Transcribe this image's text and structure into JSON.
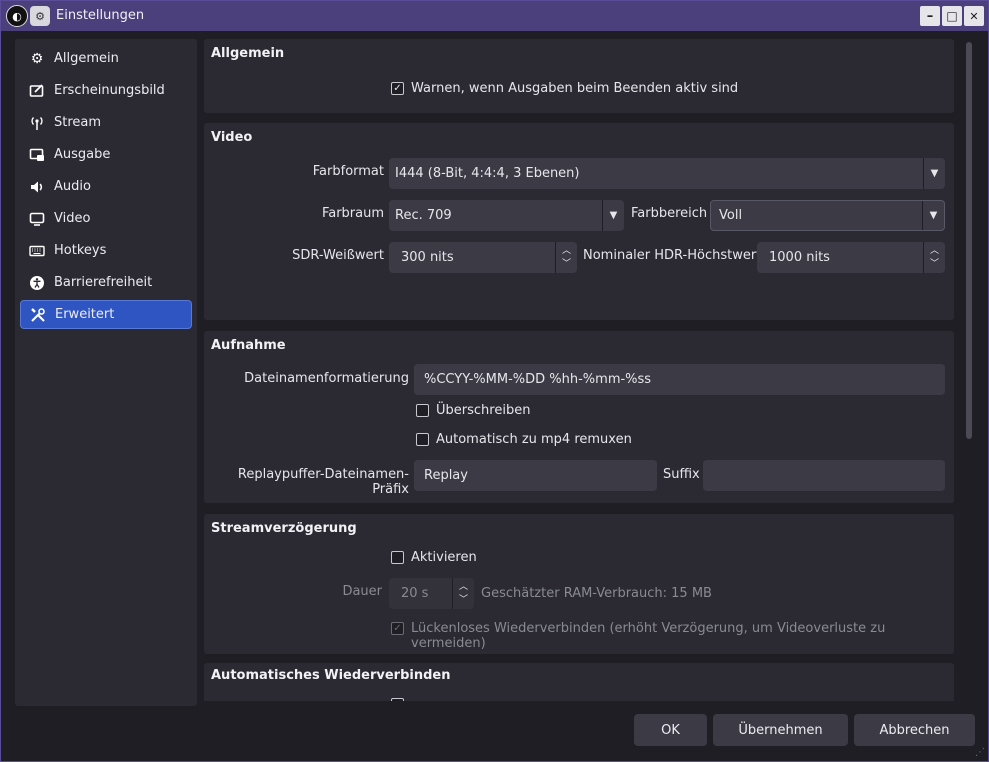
{
  "window": {
    "title": "Einstellungen",
    "buttons": {
      "minimize": "–",
      "maximize": "□",
      "close": "✕"
    }
  },
  "sidebar": {
    "items": [
      {
        "label": "Allgemein",
        "icon": "gear-icon"
      },
      {
        "label": "Erscheinungsbild",
        "icon": "appearance-icon"
      },
      {
        "label": "Stream",
        "icon": "antenna-icon"
      },
      {
        "label": "Ausgabe",
        "icon": "output-icon"
      },
      {
        "label": "Audio",
        "icon": "speaker-icon"
      },
      {
        "label": "Video",
        "icon": "monitor-icon"
      },
      {
        "label": "Hotkeys",
        "icon": "keyboard-icon"
      },
      {
        "label": "Barrierefreiheit",
        "icon": "accessibility-icon"
      },
      {
        "label": "Erweitert",
        "icon": "tools-icon",
        "active": true
      }
    ]
  },
  "general": {
    "title": "Allgemein",
    "warn_checkbox": {
      "label": "Warnen, wenn Ausgaben beim Beenden aktiv sind",
      "checked": true
    }
  },
  "video": {
    "title": "Video",
    "color_format_label": "Farbformat",
    "color_format_value": "I444 (8-Bit, 4:4:4, 3 Ebenen)",
    "color_space_label": "Farbraum",
    "color_space_value": "Rec. 709",
    "color_range_label": "Farbbereich",
    "color_range_value": "Voll",
    "sdr_white_label": "SDR-Weißwert",
    "sdr_white_value": "300 nits",
    "hdr_peak_label": "Nominaler HDR-Höchstwert",
    "hdr_peak_value": "1000 nits"
  },
  "recording": {
    "title": "Aufnahme",
    "filename_format_label": "Dateinamenformatierung",
    "filename_format_value": "%CCYY-%MM-%DD %hh-%mm-%ss",
    "overwrite_label": "Überschreiben",
    "overwrite_checked": false,
    "remux_label": "Automatisch zu mp4 remuxen",
    "remux_checked": false,
    "replay_prefix_label": "Replaypuffer-Dateinamen-Präfix",
    "replay_prefix_value": "Replay",
    "suffix_label": "Suffix",
    "suffix_value": ""
  },
  "stream_delay": {
    "title": "Streamverzögerung",
    "enable_label": "Aktivieren",
    "enable_checked": false,
    "duration_label": "Dauer",
    "duration_value": "20 s",
    "ram_estimate": "Geschätzter RAM-Verbrauch: 15 MB",
    "preserve_label": "Lückenloses Wiederverbinden (erhöht Verzögerung, um Videoverluste zu vermeiden)",
    "preserve_checked": true
  },
  "auto_reconnect": {
    "title": "Automatisches Wiederverbinden"
  },
  "footer": {
    "ok": "OK",
    "apply": "Übernehmen",
    "cancel": "Abbrechen"
  },
  "colors": {
    "accent": "#2f55c2",
    "titlebar": "#4b3f7c",
    "panel": "#2b2a33",
    "field": "#3c3b45",
    "background": "#1f1e25"
  }
}
